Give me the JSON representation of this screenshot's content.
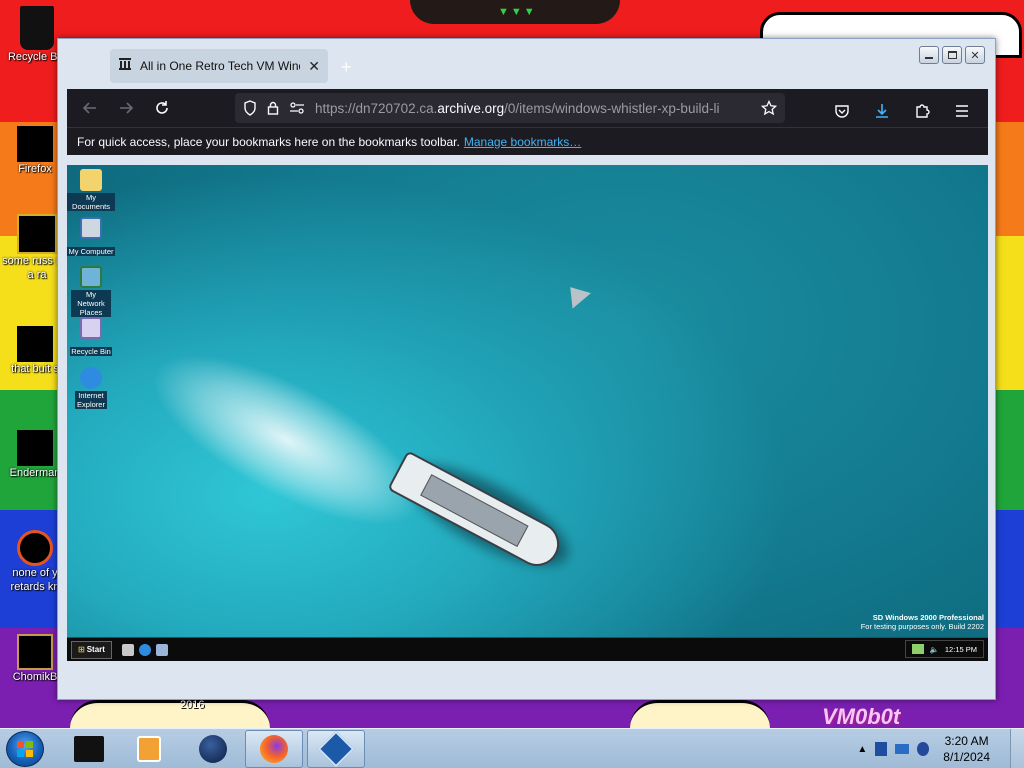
{
  "host_desktop": {
    "icons": [
      {
        "name": "recycle-bin",
        "label": "Recycle Bin"
      },
      {
        "name": "firefox",
        "label": "Firefox"
      },
      {
        "name": "some-russ",
        "label": "some russ ran a ra"
      },
      {
        "name": "that-buit",
        "label": "that buit s"
      },
      {
        "name": "enderman",
        "label": "Enderman"
      },
      {
        "name": "none-of",
        "label": "none of y retards kn"
      },
      {
        "name": "chomik",
        "label": "ChomikB"
      }
    ],
    "wallpaper_year": "2016",
    "wallpaper_logo": "VM0b0t"
  },
  "browser": {
    "tab_title": "All in One Retro Tech VM Wind",
    "url_prefix": "https://dn720702.ca.",
    "url_domain": "archive.org",
    "url_suffix": "/0/items/windows-whistler-xp-build-li",
    "bookmarks_hint": "For quick access, place your bookmarks here on the bookmarks toolbar.",
    "manage_bookmarks": "Manage bookmarks…",
    "colors": {
      "toolbar": "#1c1b22",
      "link": "#42b3f5"
    }
  },
  "vm": {
    "icons": [
      {
        "name": "my-documents",
        "label": "My Documents"
      },
      {
        "name": "my-computer",
        "label": "My Computer"
      },
      {
        "name": "my-network-places",
        "label": "My Network Places"
      },
      {
        "name": "recycle-bin",
        "label": "Recycle Bin"
      },
      {
        "name": "internet-explorer",
        "label": "Internet Explorer"
      }
    ],
    "watermark_line1": "SD Windows 2000 Professional",
    "watermark_line2": "For testing purposes only. Build 2202",
    "start_label": "Start",
    "clock": "12:15 PM"
  },
  "taskbar": {
    "time": "3:20 AM",
    "date": "8/1/2024",
    "apps": [
      "explorer",
      "media-player",
      "globe",
      "firefox",
      "virtualbox"
    ],
    "active_app": "firefox"
  }
}
